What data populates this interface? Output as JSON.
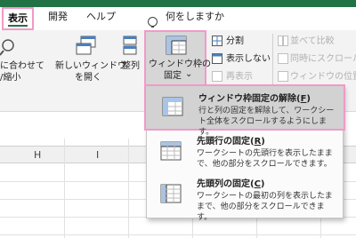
{
  "tabs": {
    "view": "表示",
    "developer": "開発",
    "help": "ヘルプ",
    "tell_me": "何をしますか"
  },
  "ribbon": {
    "zoom_label_line1": "に合わせて",
    "zoom_label_line2": "/縮小",
    "new_window_line1": "新しいウィンドウ",
    "new_window_line2": "を開く",
    "arrange": "整列",
    "freeze_line1": "ウィンドウ枠の",
    "freeze_line2": "固定",
    "freeze_chevron": "⌄",
    "split": "分割",
    "hide": "表示しない",
    "unhide": "再表示",
    "side_by_side": "並べて比較",
    "sync_scroll": "同時にスクロール",
    "reset_position": "ウィンドウの位置を"
  },
  "sheet": {
    "columns": [
      "H",
      "I",
      "J"
    ]
  },
  "menu": {
    "items": [
      {
        "title": "ウィンドウ枠固定の解除(",
        "key": "F",
        "title_end": ")",
        "desc_line1": "行と列の固定を解除して、ワークシー",
        "desc_line2": "ト全体をスクロールするようにします。"
      },
      {
        "title": "先頭行の固定(",
        "key": "R",
        "title_end": ")",
        "desc_line1": "ワークシートの先頭行を表示したまま",
        "desc_line2": "で、他の部分をスクロールできます。"
      },
      {
        "title": "先頭列の固定(",
        "key": "C",
        "title_end": ")",
        "desc_line1": "ワークシートの最初の列を表示したま",
        "desc_line2": "まで、他の部分をスクロールできます。"
      }
    ]
  },
  "colors": {
    "accent_green": "#217346",
    "highlight_pink": "#f19ac7"
  }
}
